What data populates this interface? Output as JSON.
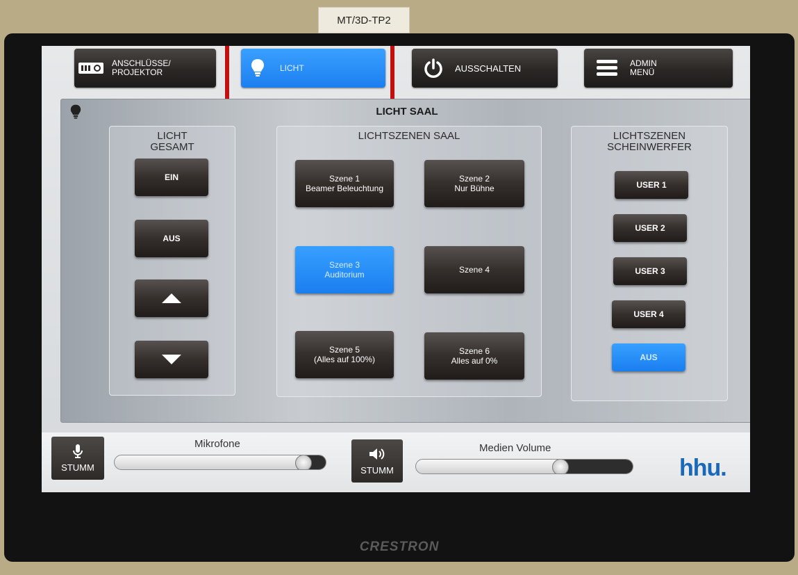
{
  "wall_label": "MT/3D-TP2",
  "brand": "CRESTRON",
  "topnav": [
    {
      "label": "ANSCHLÜSSE/\nPROJEKTOR",
      "icon": "projector-icon",
      "active": false
    },
    {
      "label": "LICHT",
      "icon": "lightbulb-icon",
      "active": true
    },
    {
      "label": "AUSSCHALTEN",
      "icon": "power-icon",
      "active": false
    },
    {
      "label": "ADMIN\nMENÜ",
      "icon": "menu-icon",
      "active": false
    }
  ],
  "main": {
    "title": "LICHT SAAL",
    "gesamt": {
      "title": "LICHT\nGESAMT",
      "on": "EIN",
      "off": "AUS"
    },
    "saal": {
      "title": "LICHTSZENEN SAAL",
      "scenes": [
        {
          "line1": "Szene 1",
          "line2": "Beamer Beleuchtung",
          "active": false
        },
        {
          "line1": "Szene 2",
          "line2": "Nur Bühne",
          "active": false
        },
        {
          "line1": "Szene 3",
          "line2": "Auditorium",
          "active": true
        },
        {
          "line1": "Szene 4",
          "line2": "",
          "active": false
        },
        {
          "line1": "Szene 5",
          "line2": "(Alles auf 100%)",
          "active": false
        },
        {
          "line1": "Szene 6",
          "line2": "Alles auf 0%",
          "active": false
        }
      ]
    },
    "scheinwerfer": {
      "title": "LICHTSZENEN\nSCHEINWERFER",
      "buttons": [
        {
          "label": "USER 1",
          "active": false
        },
        {
          "label": "USER 2",
          "active": false
        },
        {
          "label": "USER 3",
          "active": false
        },
        {
          "label": "USER 4",
          "active": false
        },
        {
          "label": "AUS",
          "active": true
        }
      ]
    }
  },
  "bottom": {
    "mic_mute_label": "STUMM",
    "mic_label": "Mikrofone",
    "mic_level": 0.93,
    "media_mute_label": "STUMM",
    "media_label": "Medien Volume",
    "media_level": 0.68,
    "logo": "hhu."
  },
  "colors": {
    "accent_blue": "#1c7ff0",
    "highlight_red": "#c40f0f",
    "logo_blue": "#1a68b8"
  }
}
